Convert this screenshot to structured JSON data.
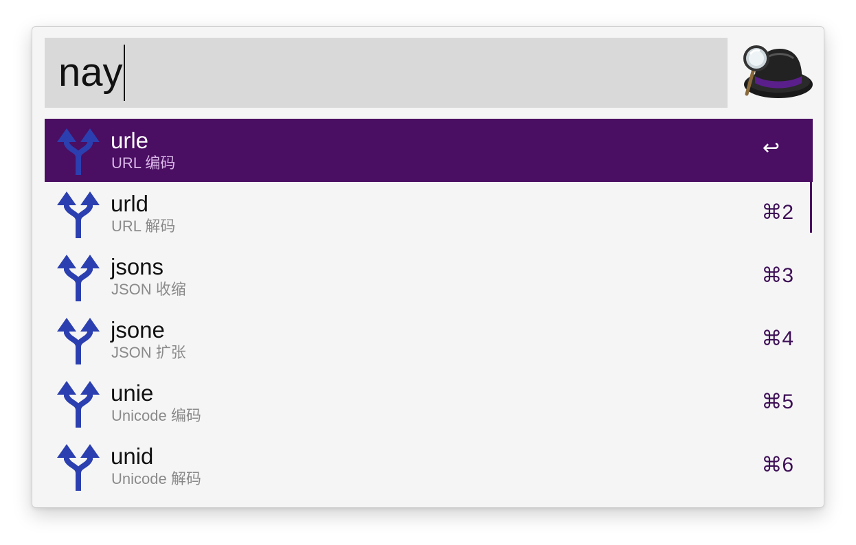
{
  "search": {
    "query": "nay"
  },
  "colors": {
    "accent": "#4a0e62",
    "icon_blue": "#2b3fb0",
    "shortcut": "#3e1057",
    "subtitle": "#8a8a8a"
  },
  "logo": {
    "icon": "alfred-hat-logo"
  },
  "results": [
    {
      "title": "urle",
      "subtitle": "URL 编码",
      "shortcut": "↩",
      "icon": "fork-arrows-icon",
      "selected": true
    },
    {
      "title": "urld",
      "subtitle": "URL 解码",
      "shortcut": "⌘2",
      "icon": "fork-arrows-icon"
    },
    {
      "title": "jsons",
      "subtitle": "JSON 收缩",
      "shortcut": "⌘3",
      "icon": "fork-arrows-icon"
    },
    {
      "title": "jsone",
      "subtitle": "JSON 扩张",
      "shortcut": "⌘4",
      "icon": "fork-arrows-icon"
    },
    {
      "title": "unie",
      "subtitle": "Unicode 编码",
      "shortcut": "⌘5",
      "icon": "fork-arrows-icon"
    },
    {
      "title": "unid",
      "subtitle": "Unicode 解码",
      "shortcut": "⌘6",
      "icon": "fork-arrows-icon"
    }
  ]
}
